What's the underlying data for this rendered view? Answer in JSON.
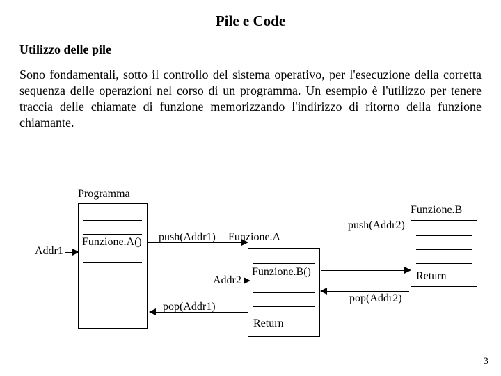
{
  "title": "Pile e Code",
  "subtitle": "Utilizzo delle pile",
  "paragraph": "Sono fondamentali, sotto il controllo del sistema operativo,  per l'esecuzione della corretta sequenza delle operazioni nel corso di un programma. Un esempio è l'utilizzo per tenere traccia delle chiamate di funzione memorizzando l'indirizzo di ritorno della funzione chiamante.",
  "labels": {
    "programma": "Programma",
    "funzioneA_title": "Funzione.A",
    "funzioneB_title": "Funzione.B",
    "funzioneA_call": "Funzione.A()",
    "funzioneB_call": "Funzione.B()",
    "addr1": "Addr1",
    "addr2": "Addr2",
    "push1": "push(Addr1)",
    "push2": "push(Addr2)",
    "pop1": "pop(Addr1)",
    "pop2": "pop(Addr2)",
    "return1": "Return",
    "return2": "Return"
  },
  "page": "3"
}
